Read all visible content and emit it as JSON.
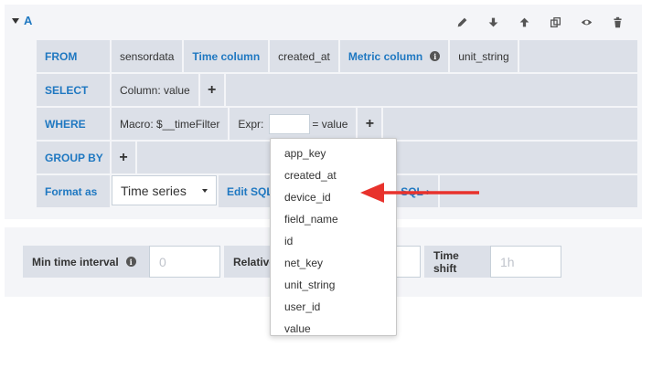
{
  "query": {
    "ref": "A",
    "rows": {
      "from": {
        "keyword": "FROM",
        "table": "sensordata",
        "time_col_label": "Time column",
        "time_col_value": "created_at",
        "metric_col_label": "Metric column",
        "metric_col_value": "unit_string"
      },
      "select": {
        "keyword": "SELECT",
        "column": "Column: value",
        "add": "+"
      },
      "where": {
        "keyword": "WHERE",
        "macro": "Macro: $__timeFilter",
        "expr_label": "Expr:",
        "expr_value": "",
        "expr_suffix": "= value",
        "add": "+"
      },
      "group_by": {
        "keyword": "GROUP BY",
        "add": "+"
      },
      "format": {
        "keyword": "Format as",
        "selected": "Time series",
        "edit_sql": "Edit SQL",
        "show_sql_partial": "ted SQL ›"
      }
    }
  },
  "options": {
    "min_interval_label": "Min time interval",
    "min_interval_placeholder": "0",
    "relative_label_partial": "Relative",
    "time_shift_label": "Time shift",
    "time_shift_placeholder": "1h"
  },
  "dropdown": {
    "items": [
      "app_key",
      "created_at",
      "device_id",
      "field_name",
      "id",
      "net_key",
      "unit_string",
      "user_id",
      "value"
    ]
  },
  "colors": {
    "accent": "#1f78c1",
    "cell_bg": "#dce0e8",
    "panel_bg": "#f4f5f8",
    "arrow": "#e8322c"
  },
  "icons": [
    "pencil-icon",
    "arrow-down-icon",
    "arrow-up-icon",
    "duplicate-icon",
    "eye-icon",
    "trash-icon",
    "info-icon",
    "chevron-down-icon"
  ]
}
